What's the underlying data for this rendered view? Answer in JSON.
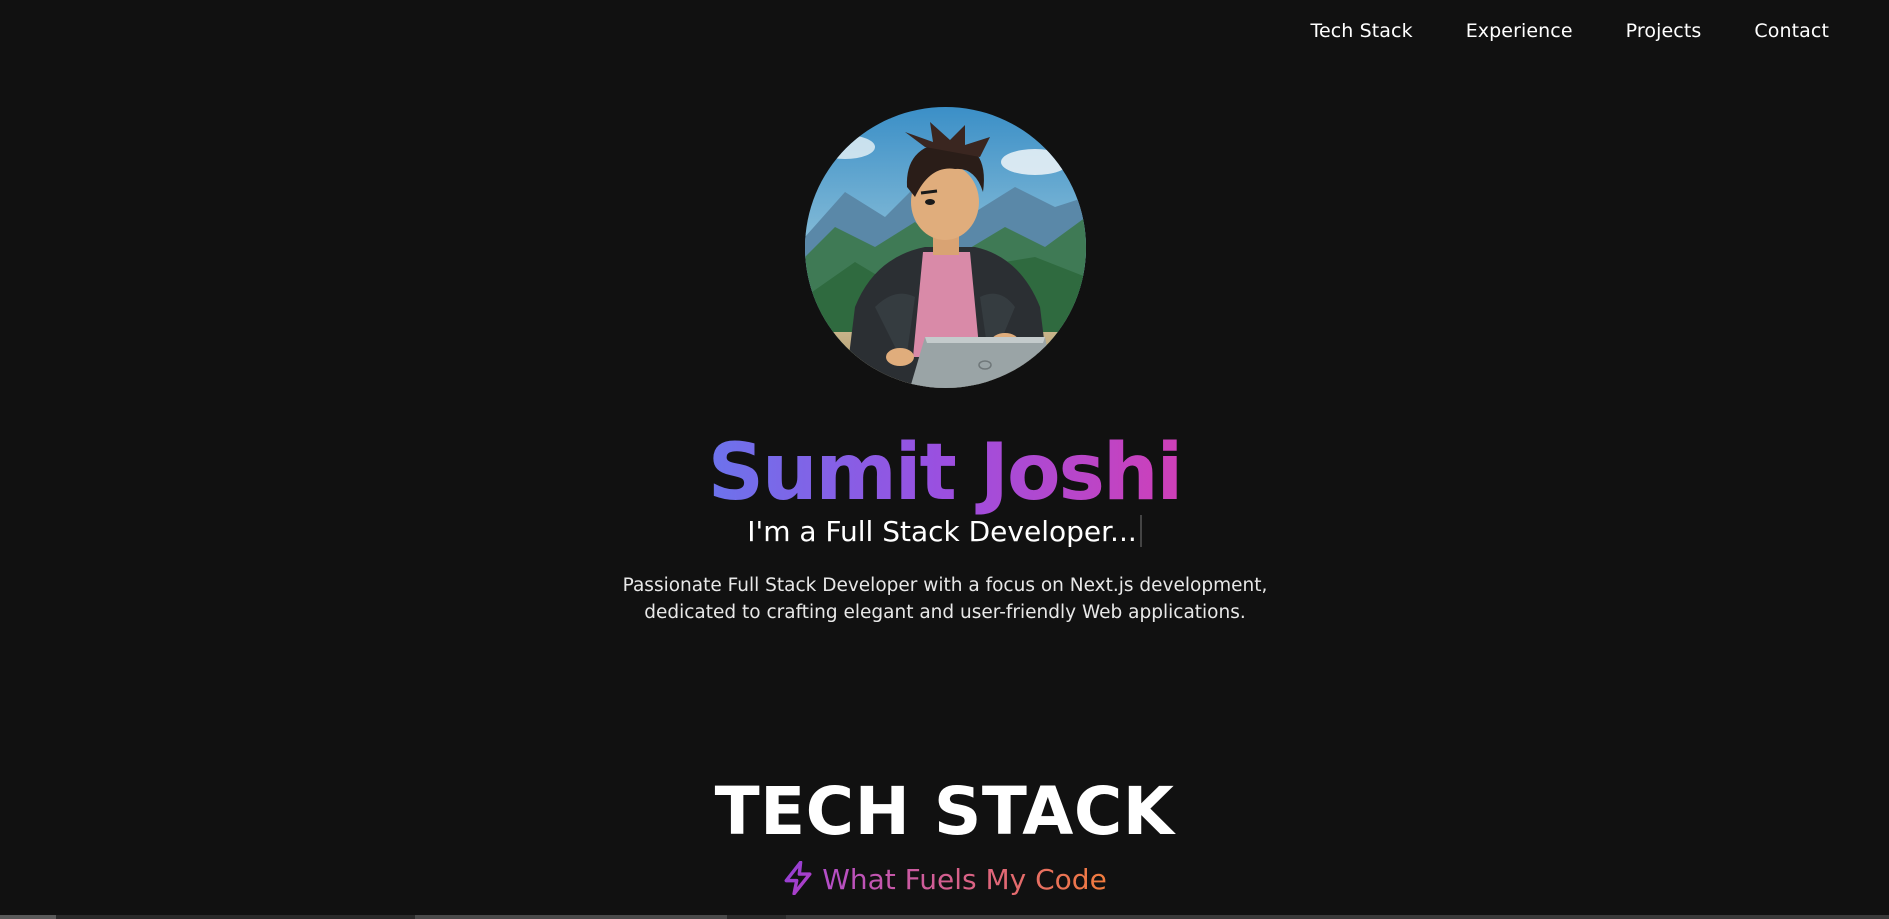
{
  "nav": {
    "items": [
      {
        "label": "Tech Stack"
      },
      {
        "label": "Experience"
      },
      {
        "label": "Projects"
      },
      {
        "label": "Contact"
      }
    ]
  },
  "hero": {
    "name": "Sumit Joshi",
    "role": "I'm a Full Stack Developer...",
    "bio_line1": "Passionate Full Stack Developer with a focus on Next.js development,",
    "bio_line2": "dedicated to crafting elegant and user-friendly Web applications."
  },
  "tech_stack": {
    "title": "TECH STACK",
    "subtitle": "What Fuels My Code",
    "icon": "lightning-bolt-icon"
  },
  "colors": {
    "background": "#111111",
    "name_gradient_start": "#6c73ec",
    "name_gradient_end": "#cf3fb8",
    "subtitle_gradient_start": "#b34dc9",
    "subtitle_gradient_end": "#f27c3c"
  }
}
